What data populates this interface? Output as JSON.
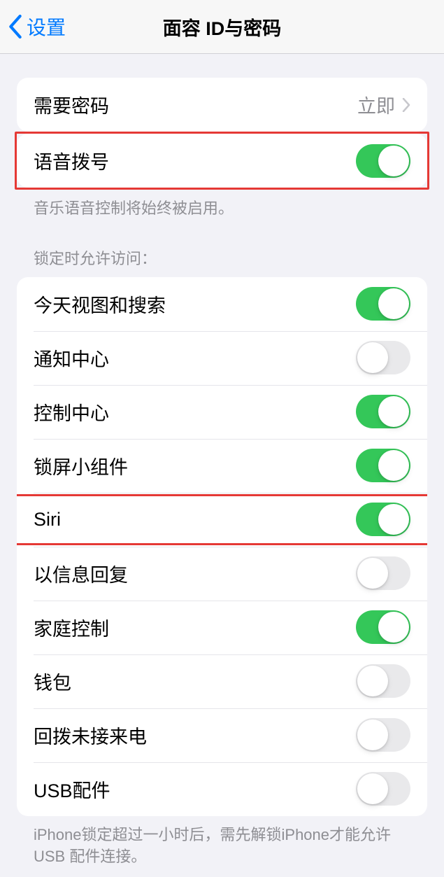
{
  "nav": {
    "back_label": "设置",
    "title": "面容 ID与密码"
  },
  "passcode_group": {
    "require_passcode": {
      "label": "需要密码",
      "value": "立即"
    }
  },
  "voice_dial_group": {
    "voice_dial": {
      "label": "语音拨号",
      "on": true
    },
    "footer": "音乐语音控制将始终被启用。"
  },
  "lock_access": {
    "header": "锁定时允许访问：",
    "items": [
      {
        "label": "今天视图和搜索",
        "on": true
      },
      {
        "label": "通知中心",
        "on": false
      },
      {
        "label": "控制中心",
        "on": true
      },
      {
        "label": "锁屏小组件",
        "on": true
      },
      {
        "label": "Siri",
        "on": true
      },
      {
        "label": "以信息回复",
        "on": false
      },
      {
        "label": "家庭控制",
        "on": true
      },
      {
        "label": "钱包",
        "on": false
      },
      {
        "label": "回拨未接来电",
        "on": false
      },
      {
        "label": "USB配件",
        "on": false
      }
    ],
    "footer": "iPhone锁定超过一小时后，需先解锁iPhone才能允许USB 配件连接。"
  }
}
